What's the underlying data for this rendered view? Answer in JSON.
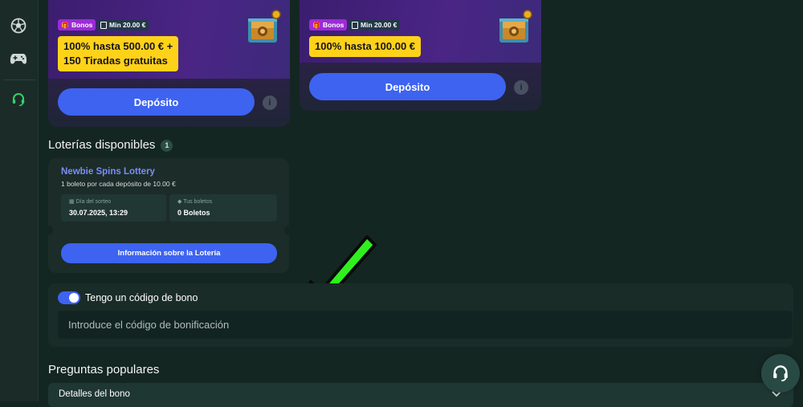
{
  "sidebar": {
    "items": [
      {
        "icon": "soccer-ball-icon"
      },
      {
        "icon": "gamepad-icon"
      },
      {
        "icon": "headset-icon"
      }
    ]
  },
  "bonus_cards": [
    {
      "badge_bonos": "Bonos",
      "badge_min": "Min 20.00 €",
      "offer_line1": "100% hasta 500.00 € +",
      "offer_line2": "150 Tiradas gratuitas",
      "deposit_label": "Depósito",
      "info_symbol": "i"
    },
    {
      "badge_bonos": "Bonos",
      "badge_min": "Min 20.00 €",
      "offer_line1": "100% hasta 100.00 €",
      "deposit_label": "Depósito",
      "info_symbol": "i"
    }
  ],
  "lotteries": {
    "title": "Loterías disponibles",
    "count": "1",
    "item": {
      "name": "Newbie Spins Lottery",
      "subtitle": "1 boleto por cada depósito de 10.00 €",
      "draw_label": "Día del sorteo",
      "draw_value": "30.07.2025, 13:29",
      "tickets_label": "Tus boletos",
      "tickets_value": "0 Boletos",
      "info_button": "Información sobre la Lotería"
    }
  },
  "promo_code": {
    "toggle_label": "Tengo un código de bono",
    "toggle_on": true,
    "placeholder": "Introduce el código de bonificación",
    "value": ""
  },
  "faq": {
    "title": "Preguntas populares",
    "items": [
      {
        "label": "Detalles del bono"
      }
    ]
  },
  "colors": {
    "background": "#142622",
    "accent_blue": "#3d63f0",
    "offer_yellow": "#ffd21a",
    "arrow_green": "#2ff01f"
  }
}
